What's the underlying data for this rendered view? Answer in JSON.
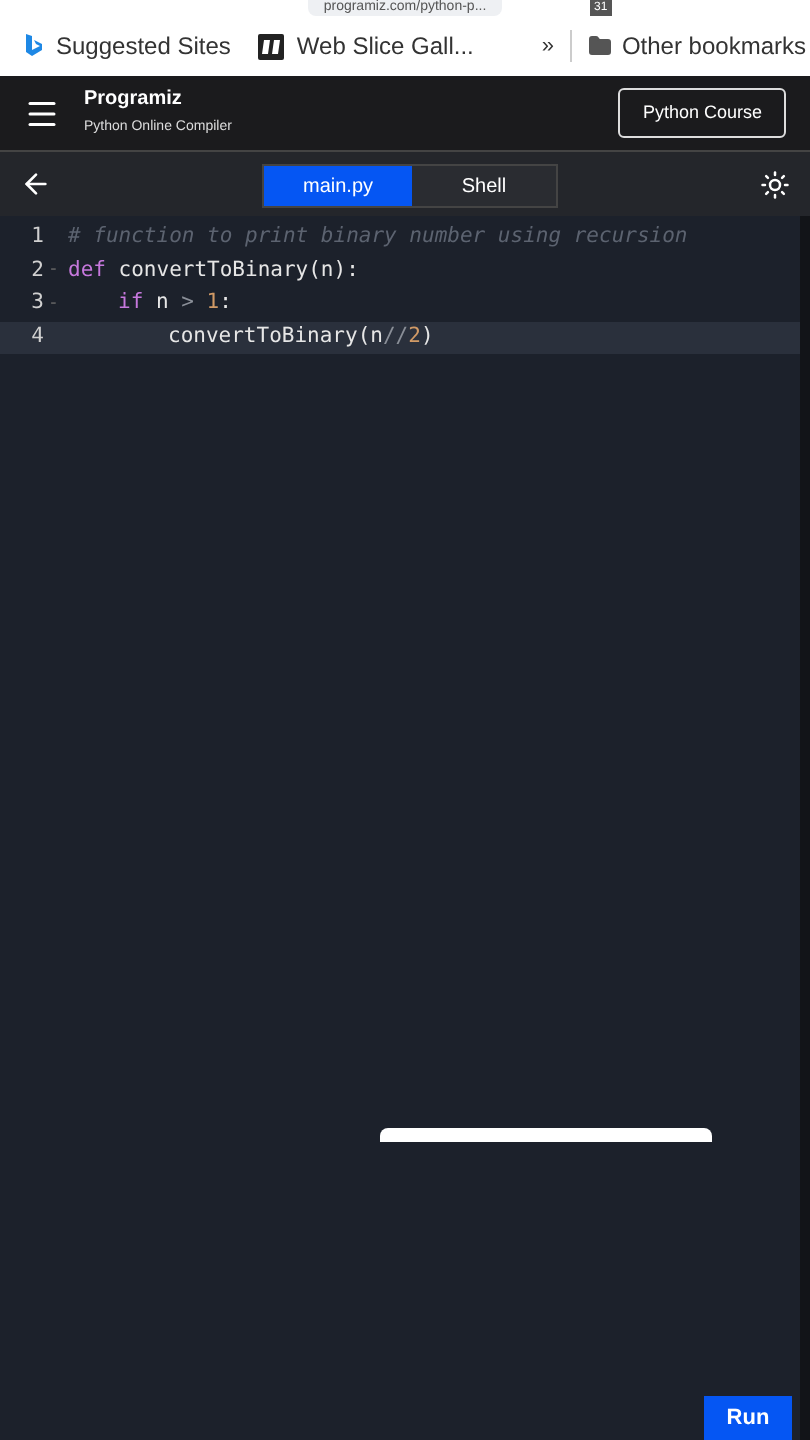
{
  "browser": {
    "url": "programiz.com/python-p...",
    "calendar_badge": "31",
    "bookmarks": [
      {
        "label": "Suggested Sites",
        "kind": "bing"
      },
      {
        "label": "Web Slice Gall...",
        "kind": "slice"
      }
    ],
    "overflow": "»",
    "other_bookmarks": "Other bookmarks"
  },
  "header": {
    "logo": "Programiz",
    "subtitle": "Python Online Compiler",
    "course_button": "Python Course"
  },
  "tabs": [
    {
      "label": "main.py",
      "selected": true
    },
    {
      "label": "Shell",
      "selected": false
    }
  ],
  "editor": {
    "lines": [
      {
        "number": "1",
        "active": false,
        "tokens": [
          {
            "text": "# function to print binary number using recursion",
            "kind": "comment"
          }
        ]
      },
      {
        "number": "2",
        "fold_marker": "-",
        "active": false,
        "tokens": [
          {
            "text": "def",
            "kind": "keyword"
          },
          {
            "text": " convertToBinary(n):",
            "kind": "plain"
          }
        ],
        "children": [
          {
            "number": "3",
            "fold_marker": "-",
            "active": false,
            "tokens": [
              {
                "text": "if",
                "kind": "keyword"
              },
              {
                "text": " n ",
                "kind": "plain"
              },
              {
                "text": ">",
                "kind": "operator"
              },
              {
                "text": " 1",
                "kind": "number"
              },
              {
                "text": ":",
                "kind": "plain"
              }
            ],
            "children": [
              {
                "number": "4",
                "active": true,
                "tokens": [
                  {
                    "text": "convertToBinary(n",
                    "kind": "plain"
                  },
                  {
                    "text": "//",
                    "kind": "operator"
                  },
                  {
                    "text": "2",
                    "kind": "number"
                  },
                  {
                    "text": ")",
                    "kind": "plain"
                  }
                ]
              }
            ]
          }
        ]
      }
    ]
  },
  "run_button": "Run"
}
